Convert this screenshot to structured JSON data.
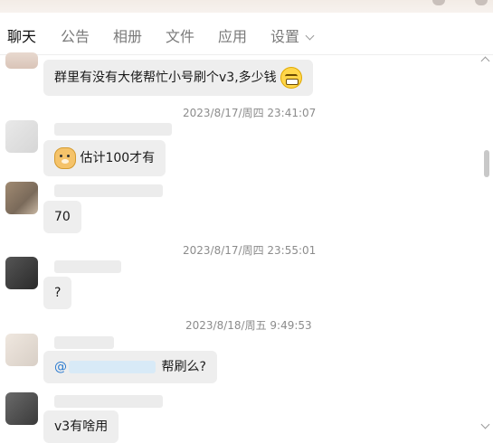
{
  "tabs": [
    {
      "label": "聊天",
      "active": true
    },
    {
      "label": "公告",
      "active": false
    },
    {
      "label": "相册",
      "active": false
    },
    {
      "label": "文件",
      "active": false
    },
    {
      "label": "应用",
      "active": false
    },
    {
      "label": "设置",
      "active": false
    }
  ],
  "messages": [
    {
      "text": "群里有没有大佬帮忙小号刷个v3,多少钱",
      "emoji": "grin-emoji"
    },
    {
      "timestamp": "2023/8/17/周四 23:41:07",
      "text": "估计100才有",
      "emoji": "dog-emoji"
    },
    {
      "text": "70"
    },
    {
      "timestamp": "2023/8/17/周四 23:55:01",
      "text": "?"
    },
    {
      "timestamp": "2023/8/18/周五 9:49:53",
      "mention_prefix": "@",
      "text": "帮刷么?"
    },
    {
      "text": "v3有啥用"
    }
  ],
  "colors": {
    "bubble": "#eeeeee",
    "mention": "#2b7bd0",
    "timestamp": "#8c8c8c"
  }
}
